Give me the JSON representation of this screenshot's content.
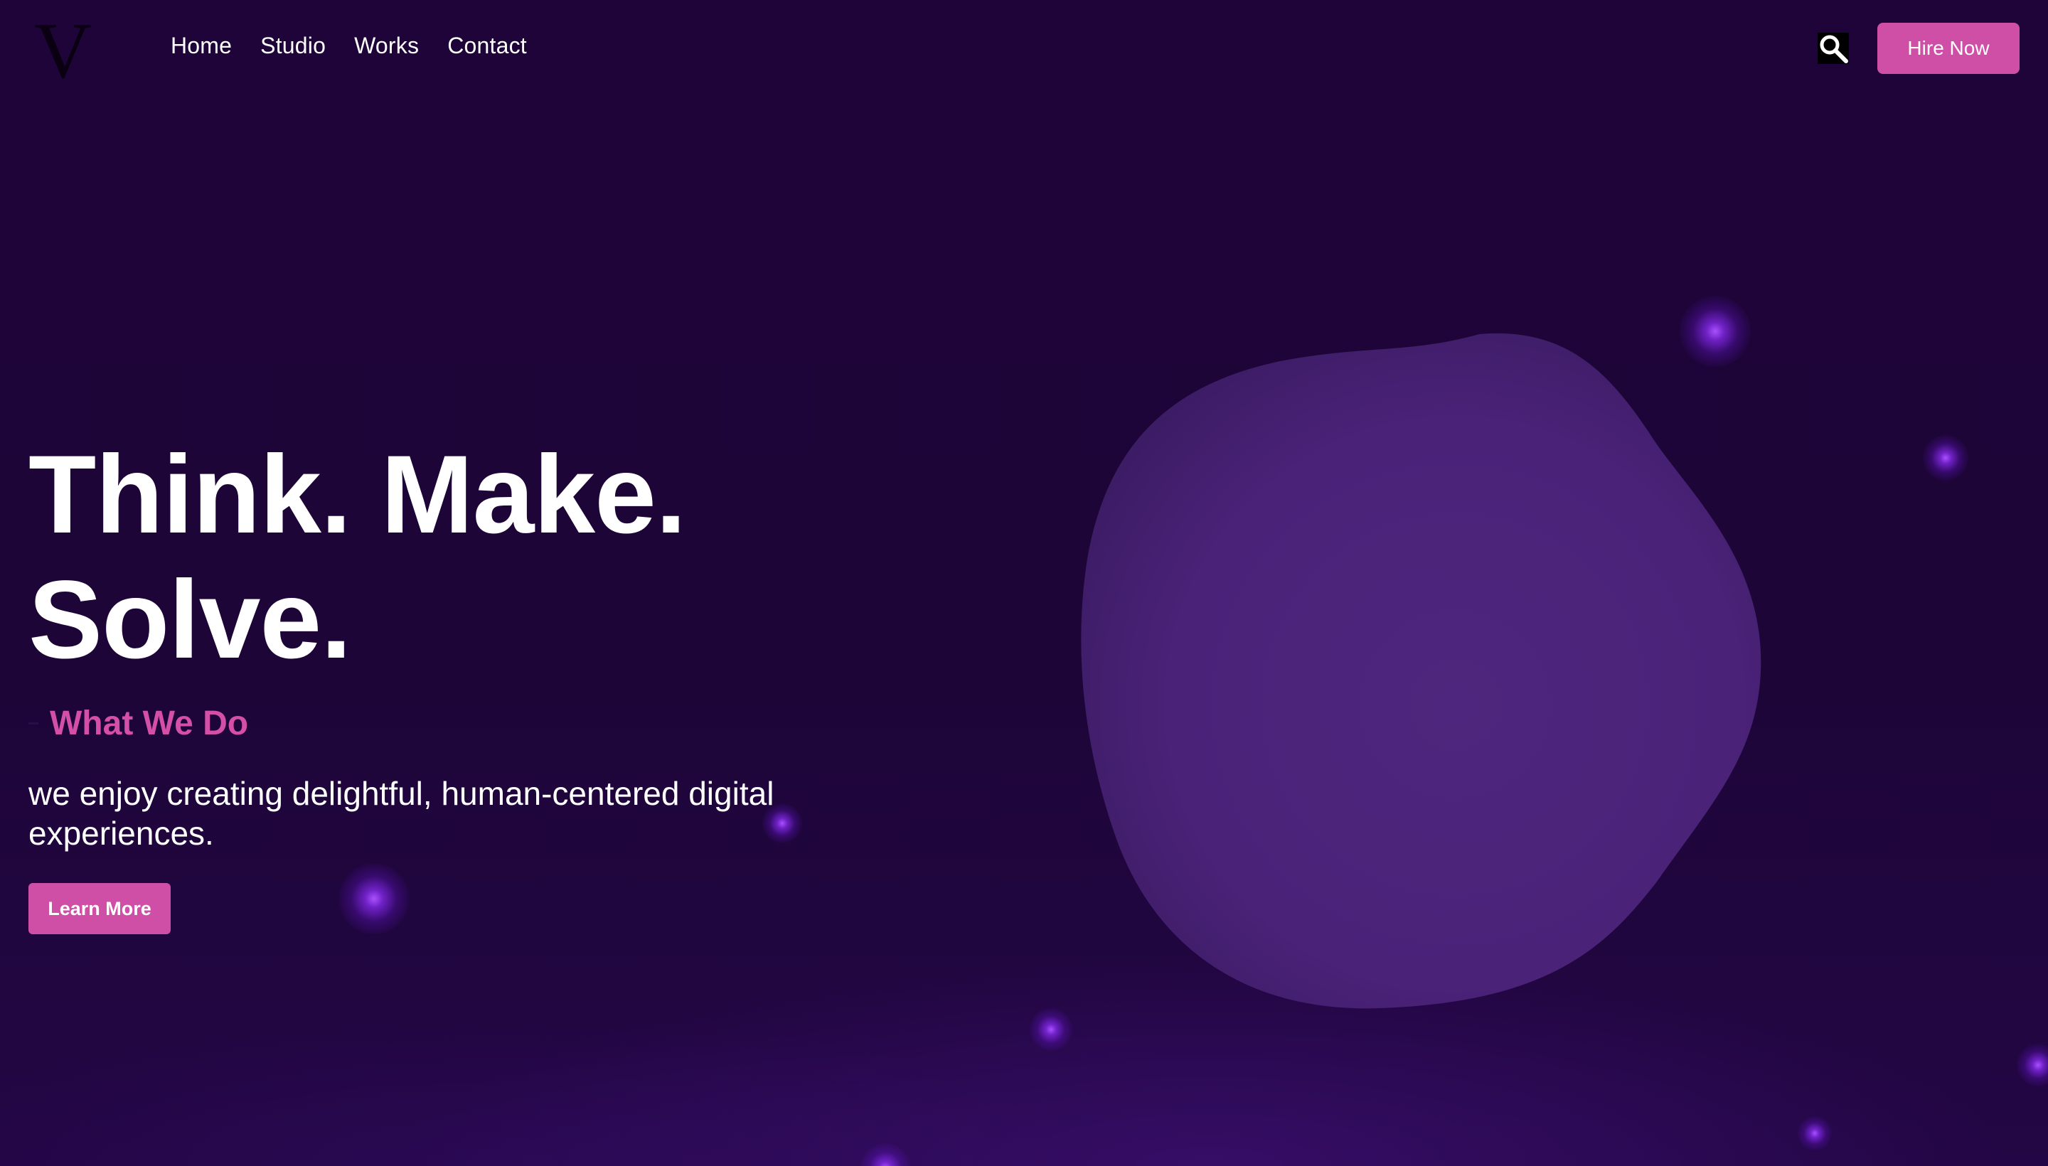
{
  "header": {
    "logo": "V",
    "nav": {
      "home": "Home",
      "studio": "Studio",
      "works": "Works",
      "contact": "Contact"
    },
    "search_icon": "search-icon",
    "hire_label": "Hire Now"
  },
  "hero": {
    "headline_line1": "Think. Make.",
    "headline_line2": "Solve.",
    "subheading": "What We Do",
    "description": "we enjoy creating delightful, human-centered digital experiences.",
    "button_label": "Learn More"
  },
  "colors": {
    "background": "#1d0538",
    "accent": "#d04fa6",
    "blob": "#4a2278",
    "glow": "#a04dff"
  }
}
